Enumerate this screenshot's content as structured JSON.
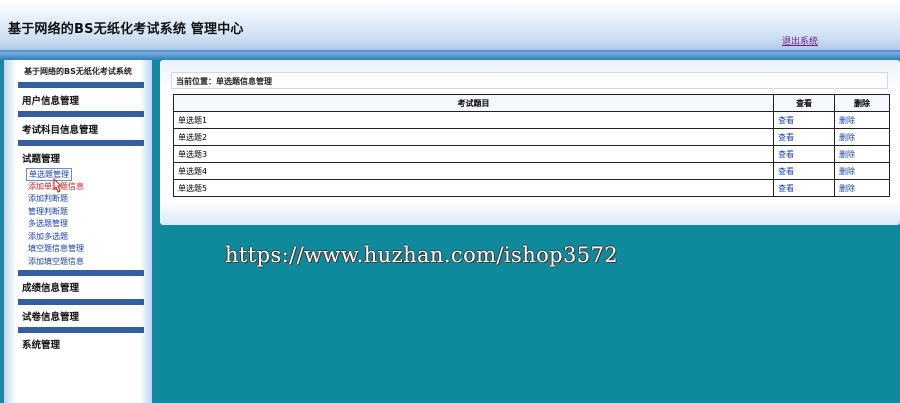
{
  "header": {
    "title": "基于网络的BS无纸化考试系统 管理中心",
    "logout_label": "退出系统"
  },
  "sidebar": {
    "title": "基于网络的BS无纸化考试系统",
    "sections": [
      {
        "label": "用户信息管理"
      },
      {
        "label": "考试科目信息管理"
      },
      {
        "label": "试题管理",
        "items": [
          "单选题管理",
          "添加单选题信息",
          "添加判断题",
          "管理判断题",
          "多选题管理",
          "添加多选题",
          "填空题信息管理",
          "添加填空题信息"
        ]
      },
      {
        "label": "成绩信息管理"
      },
      {
        "label": "试卷信息管理"
      },
      {
        "label": "系统管理"
      }
    ]
  },
  "main": {
    "location": "当前位置：单选题信息管理",
    "table": {
      "headers": [
        "考试题目",
        "查看",
        "删除"
      ],
      "rows": [
        {
          "title": "单选题1",
          "view": "查看",
          "delete": "删除"
        },
        {
          "title": "单选题2",
          "view": "查看",
          "delete": "删除"
        },
        {
          "title": "单选题3",
          "view": "查看",
          "delete": "删除"
        },
        {
          "title": "单选题4",
          "view": "查看",
          "delete": "删除"
        },
        {
          "title": "单选题5",
          "view": "查看",
          "delete": "删除"
        }
      ]
    }
  },
  "watermark": "https://www.huzhan.com/ishop3572"
}
